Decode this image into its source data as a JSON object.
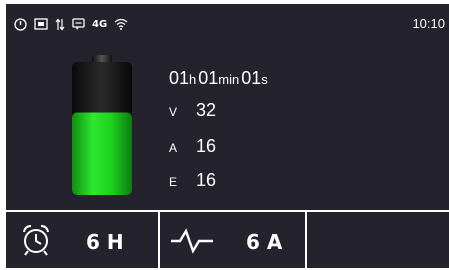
{
  "status_bar": {
    "icons": [
      "power-icon",
      "screen-icon",
      "updown-arrows-icon",
      "chat-icon",
      "wifi-icon"
    ],
    "network_label": "4G",
    "time": "10:10"
  },
  "battery": {
    "level": 0.62,
    "color": "#1fd11f"
  },
  "timer": {
    "hours": "01",
    "hours_unit": "h",
    "minutes": "01",
    "minutes_unit": "min",
    "seconds": "01",
    "seconds_unit": "s"
  },
  "readings": [
    {
      "label": "V",
      "value": "32"
    },
    {
      "label": "A",
      "value": "16"
    },
    {
      "label": "E",
      "value": "16"
    }
  ],
  "bottom": {
    "duration": {
      "icon": "alarm-clock-icon",
      "value": "6 H"
    },
    "current": {
      "icon": "waveform-icon",
      "value": "6 A"
    }
  }
}
